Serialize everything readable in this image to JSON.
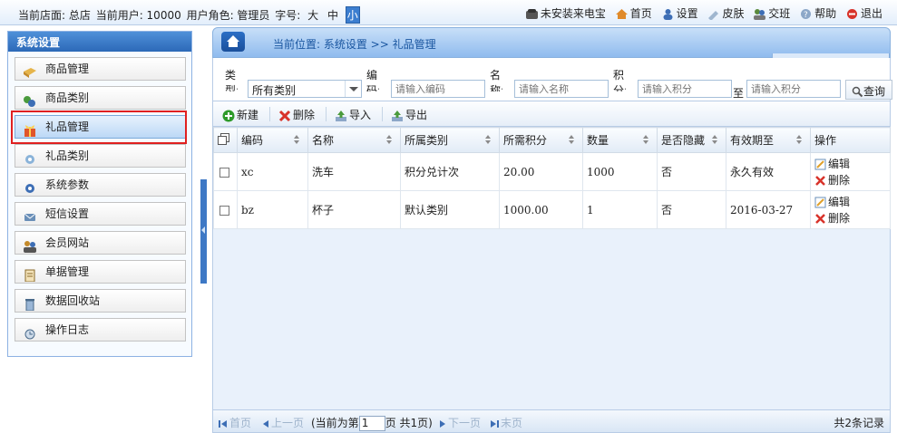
{
  "topbar": {
    "store_label": "当前店面: 总店",
    "user_label": "当前用户: 10000",
    "role_label": "用户角色: 管理员",
    "font_label": "字号:",
    "font_sizes": [
      "大",
      "中",
      "小"
    ],
    "font_selected": "小",
    "links": [
      {
        "label": "未安装来电宝",
        "icon": "phone-icon"
      },
      {
        "label": "首页",
        "icon": "home-icon"
      },
      {
        "label": "设置",
        "icon": "user-settings-icon"
      },
      {
        "label": "皮肤",
        "icon": "skin-icon"
      },
      {
        "label": "交班",
        "icon": "handover-icon"
      },
      {
        "label": "帮助",
        "icon": "help-icon"
      },
      {
        "label": "退出",
        "icon": "exit-icon"
      }
    ]
  },
  "sidebar": {
    "title": "系统设置",
    "items": [
      {
        "label": "商品管理",
        "icon": "box-icon"
      },
      {
        "label": "商品类别",
        "icon": "category-icon"
      },
      {
        "label": "礼品管理",
        "icon": "gift-icon",
        "selected": true
      },
      {
        "label": "礼品类别",
        "icon": "gift-category-icon"
      },
      {
        "label": "系统参数",
        "icon": "gear-icon"
      },
      {
        "label": "短信设置",
        "icon": "sms-icon"
      },
      {
        "label": "会员网站",
        "icon": "members-icon"
      },
      {
        "label": "单据管理",
        "icon": "document-icon"
      },
      {
        "label": "数据回收站",
        "icon": "recycle-icon"
      },
      {
        "label": "操作日志",
        "icon": "log-icon"
      }
    ]
  },
  "breadcrumb": {
    "text": "当前位置: 系统设置 >> 礼品管理"
  },
  "filter": {
    "type_label": "类型:",
    "type_value": "所有类别",
    "code_label": "编码:",
    "code_placeholder": "请输入编码",
    "name_label": "名称:",
    "name_placeholder": "请输入名称",
    "points_label": "积分:",
    "points_from_placeholder": "请输入积分",
    "to_label": "至",
    "points_to_placeholder": "请输入积分",
    "query_label": "查询"
  },
  "toolbar": {
    "new_label": "新建",
    "delete_label": "删除",
    "import_label": "导入",
    "export_label": "导出"
  },
  "table": {
    "columns": [
      "编码",
      "名称",
      "所属类别",
      "所需积分",
      "数量",
      "是否隐藏",
      "有效期至",
      "操作"
    ],
    "rows": [
      {
        "code": "xc",
        "name": "洗车",
        "category": "积分兑计次",
        "points": "20.00",
        "qty": "1000",
        "hidden": "否",
        "expiry": "永久有效",
        "edit": "编辑",
        "del": "删除"
      },
      {
        "code": "bz",
        "name": "杯子",
        "category": "默认类别",
        "points": "1000.00",
        "qty": "1",
        "hidden": "否",
        "expiry": "2016-03-27",
        "edit": "编辑",
        "del": "删除"
      }
    ]
  },
  "pager": {
    "first": "首页",
    "prev": "上一页",
    "current_prefix": "(当前为第",
    "current_page": "1",
    "current_suffix": "页 共1页)",
    "next": "下一页",
    "last": "末页",
    "total": "共2条记录"
  },
  "colors": {
    "accent": "#2c69b8",
    "selected_outline": "#e02020"
  }
}
